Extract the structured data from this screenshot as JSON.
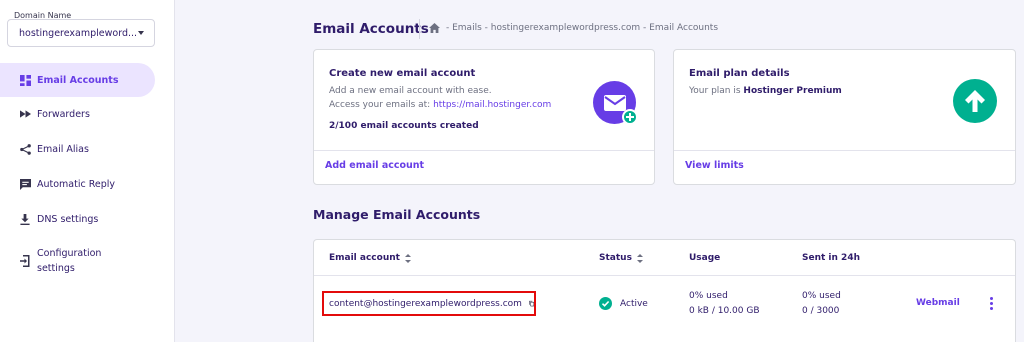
{
  "sidebar": {
    "domain_label": "Domain Name",
    "domain_value": "hostingerexampleword...",
    "items": [
      {
        "label": "Email Accounts",
        "icon": "dashboard-icon",
        "active": true
      },
      {
        "label": "Forwarders",
        "icon": "fast-forward-icon",
        "active": false
      },
      {
        "label": "Email Alias",
        "icon": "share-icon",
        "active": false
      },
      {
        "label": "Automatic Reply",
        "icon": "chat-icon",
        "active": false
      },
      {
        "label": "DNS settings",
        "icon": "download-icon",
        "active": false
      },
      {
        "label": "Configuration",
        "label2": "settings",
        "icon": "login-icon",
        "active": false
      }
    ]
  },
  "header": {
    "title": "Email Accounts",
    "breadcrumb": "- Emails - hostingerexamplewordpress.com - Email Accounts"
  },
  "create_card": {
    "title": "Create new email account",
    "line1": "Add a new email account with ease.",
    "line2_prefix": "Access your emails at: ",
    "line2_link": "https://mail.hostinger.com",
    "count": "2/100 email accounts created",
    "action": "Add email account"
  },
  "plan_card": {
    "title": "Email plan details",
    "text_prefix": "Your plan is ",
    "plan": "Hostinger Premium",
    "action": "View limits"
  },
  "manage": {
    "title": "Manage Email Accounts",
    "columns": [
      "Email account",
      "Status",
      "Usage",
      "Sent in 24h"
    ],
    "rows": [
      {
        "email": "content@hostingerexamplewordpress.com",
        "status": "Active",
        "usage_pct": "0% used",
        "usage_size": "0 kB / 10.00 GB",
        "sent_pct": "0% used",
        "sent_count": "0 / 3000",
        "action": "Webmail"
      }
    ]
  },
  "colors": {
    "accent": "#673de6",
    "success": "#00b090",
    "highlight_border": "#e30b0b",
    "active_bg": "#ebe4ff"
  }
}
